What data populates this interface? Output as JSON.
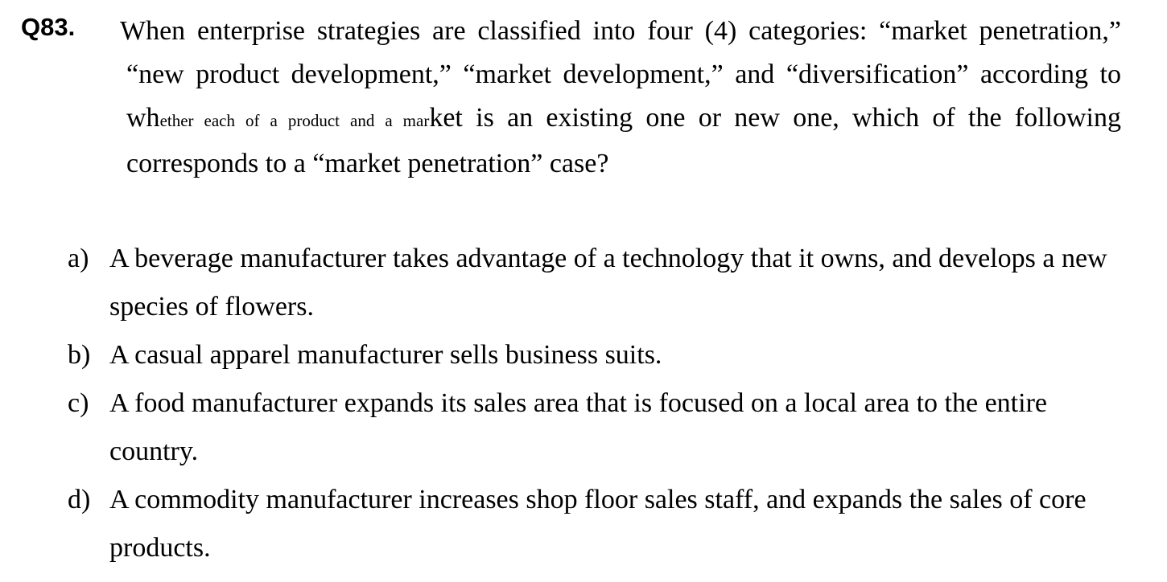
{
  "question": {
    "number": "Q83.",
    "text_part1": "When enterprise strategies are classified into four (4) categories: “market penetration,” “new product development,” “market development,” and “diversification” according to wh",
    "text_small": "ether each of a product and a mar",
    "text_part2": "ket is an existing one or new one, which of the following corresponds to a “market penetration” case?"
  },
  "options": [
    {
      "letter": "a)",
      "text": "A beverage manufacturer takes advantage of a technology that it owns, and develops a new species of flowers."
    },
    {
      "letter": "b)",
      "text": "A casual apparel manufacturer sells business suits."
    },
    {
      "letter": "c)",
      "text": "A food manufacturer expands its sales area that is focused on a local area to the entire country."
    },
    {
      "letter": "d)",
      "text": "A commodity manufacturer increases shop floor sales staff, and expands the sales of core products."
    }
  ]
}
